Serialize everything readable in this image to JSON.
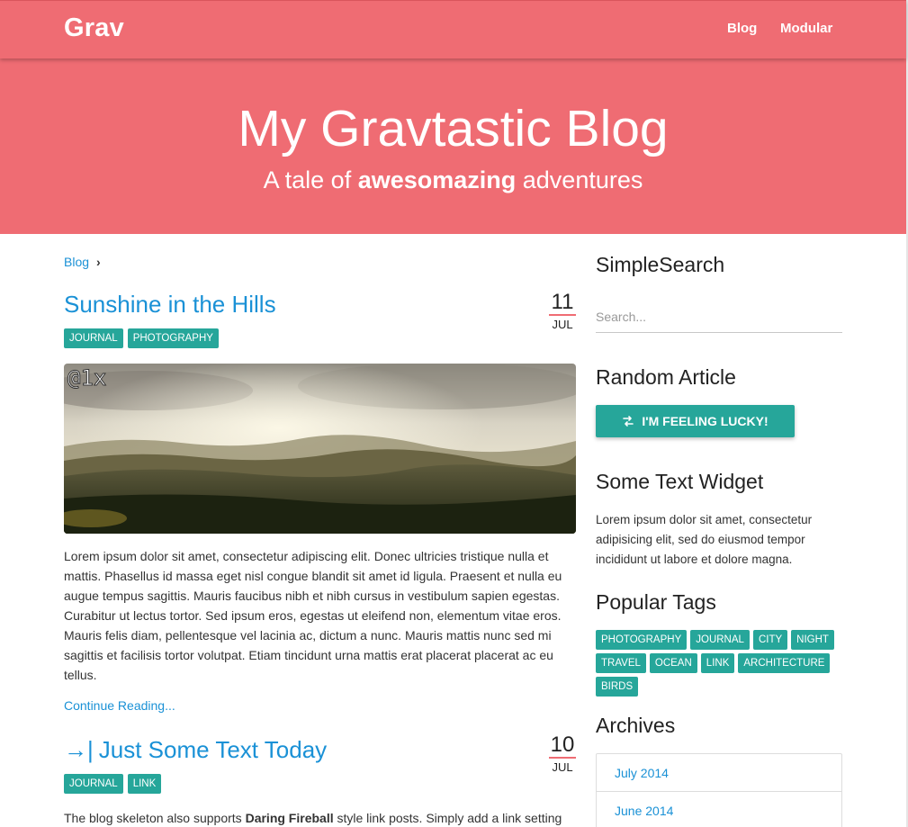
{
  "nav": {
    "logo": "Grav",
    "links": [
      "Blog",
      "Modular"
    ]
  },
  "hero": {
    "title": "My Gravtastic Blog",
    "subtitle_pre": "A tale of ",
    "subtitle_bold": "awesomazing",
    "subtitle_post": " adventures"
  },
  "breadcrumb": {
    "link": "Blog",
    "separator": "›"
  },
  "posts": [
    {
      "title": "Sunshine in the Hills",
      "day": "11",
      "month": "JUL",
      "tags": [
        "JOURNAL",
        "PHOTOGRAPHY"
      ],
      "image_badge": "@1x",
      "body": "Lorem ipsum dolor sit amet, consectetur adipiscing elit. Donec ultricies tristique nulla et mattis. Phasellus id massa eget nisl congue blandit sit amet id ligula. Praesent et nulla eu augue tempus sagittis. Mauris faucibus nibh et nibh cursus in vestibulum sapien egestas. Curabitur ut lectus tortor. Sed ipsum eros, egestas ut eleifend non, elementum vitae eros. Mauris felis diam, pellentesque vel lacinia ac, dictum a nunc. Mauris mattis nunc sed mi sagittis et facilisis tortor volutpat. Etiam tincidunt urna mattis erat placerat placerat ac eu tellus.",
      "continue": "Continue Reading..."
    },
    {
      "title": "Just Some Text Today",
      "title_icon": "→|",
      "day": "10",
      "month": "JUL",
      "tags": [
        "JOURNAL",
        "LINK"
      ],
      "body_pre": "The blog skeleton also supports ",
      "body_bold": "Daring Fireball",
      "body_post": " style link posts. Simply add a link setting"
    }
  ],
  "sidebar": {
    "search_heading": "SimpleSearch",
    "search_placeholder": "Search...",
    "random_heading": "Random Article",
    "lucky_button": "I'M FEELING LUCKY!",
    "text_widget_heading": "Some Text Widget",
    "text_widget_body": "Lorem ipsum dolor sit amet, consectetur adipisicing elit, sed do eiusmod tempor incididunt ut labore et dolore magna.",
    "tags_heading": "Popular Tags",
    "popular_tags": [
      "PHOTOGRAPHY",
      "JOURNAL",
      "CITY",
      "NIGHT",
      "TRAVEL",
      "OCEAN",
      "LINK",
      "ARCHITECTURE",
      "BIRDS"
    ],
    "archives_heading": "Archives",
    "archives": [
      "July 2014",
      "June 2014"
    ]
  },
  "colors": {
    "brand": "#ef6c73",
    "accent": "#26a69a",
    "link": "#1a91d6"
  },
  "icons": {
    "lucky_button_icon": "shuffle-icon",
    "link_post_icon": "arrow-to-right-icon"
  }
}
